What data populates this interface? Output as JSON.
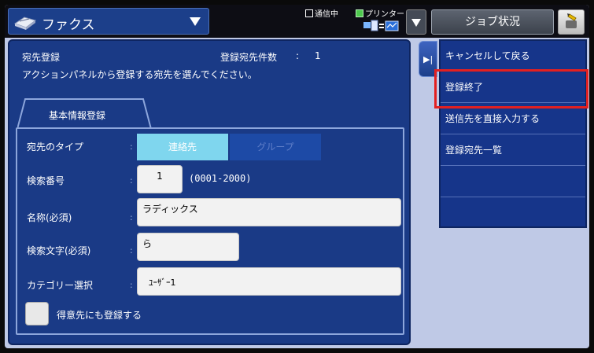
{
  "header": {
    "mode_label": "ファクス",
    "status_comm": "通信中",
    "status_printer": "プリンター",
    "job_status_label": "ジョブ状況"
  },
  "main": {
    "title": "宛先登録",
    "count_label": "登録宛先件数",
    "count_colon": ":",
    "count_value": "1",
    "instruction": "アクションパネルから登録する宛先を選んでください。",
    "tab_label": "基本情報登録"
  },
  "form": {
    "type_label": "宛先のタイプ",
    "type_option_contact": "連絡先",
    "type_option_group": "グループ",
    "search_no_label": "検索番号",
    "search_no_value": "1",
    "search_no_range": "(0001-2000)",
    "name_label": "名称(必須)",
    "name_value": "ラディックス",
    "search_text_label": "検索文字(必須)",
    "search_text_value": "ら",
    "category_label": "カテゴリー選択",
    "category_value": "ﾕｰｻﾞｰ1",
    "favorite_label": "得意先にも登録する",
    "colon": ":"
  },
  "actions": {
    "items": [
      {
        "label": "キャンセルして戻る"
      },
      {
        "label": "登録終了"
      },
      {
        "label": "送信先を直接入力する"
      },
      {
        "label": "登録宛先一覧"
      },
      {
        "label": ""
      },
      {
        "label": ""
      }
    ]
  },
  "colors": {
    "accent_blue": "#1a3a86",
    "selected_segment": "#7fd6ee",
    "highlight_red": "#e32020"
  },
  "icons": [
    "fax-icon",
    "dropdown-arrow-icon",
    "printer-icon",
    "network-icon",
    "help-icon",
    "panel-toggle-icon",
    "checkbox"
  ]
}
